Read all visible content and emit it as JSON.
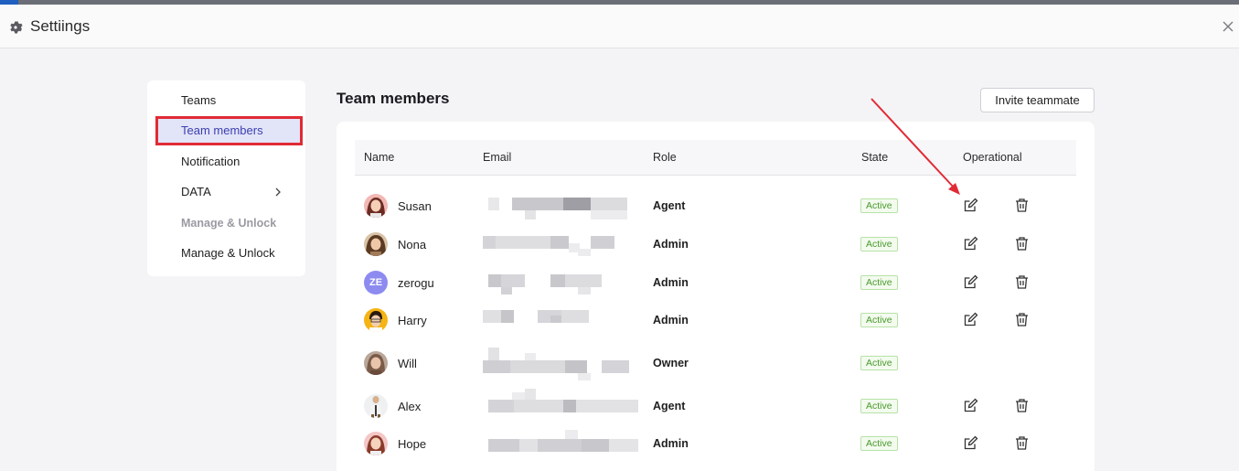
{
  "header": {
    "title": "Settiings"
  },
  "menu": {
    "items": [
      {
        "label": "Teams"
      },
      {
        "label": "Team members"
      },
      {
        "label": "Notification"
      },
      {
        "label": "DATA"
      },
      {
        "label": "Manage & Unlock"
      },
      {
        "label": "Manage & Unlock"
      }
    ]
  },
  "main": {
    "title": "Team members",
    "invite_label": "Invite teammate",
    "columns": [
      "Name",
      "Email",
      "Role",
      "State",
      "Operational"
    ],
    "rows": [
      {
        "name": "Susan",
        "role": "Agent",
        "state": "Active"
      },
      {
        "name": "Nona",
        "role": "Admin",
        "state": "Active"
      },
      {
        "name": "zerogu",
        "initials": "ZE",
        "role": "Admin",
        "state": "Active"
      },
      {
        "name": "Harry",
        "role": "Admin",
        "state": "Active"
      },
      {
        "name": "Will",
        "role": "Owner",
        "state": "Active"
      },
      {
        "name": "Alex",
        "role": "Agent",
        "state": "Active"
      },
      {
        "name": "Hope",
        "role": "Admin",
        "state": "Active"
      }
    ]
  },
  "colors": {
    "highlight_red": "#e02b35",
    "active_menu_bg": "#e2e4f8",
    "state_green": "#4a9a2c",
    "avatar_initials_bg": "#8d8bf0"
  },
  "icons": [
    "gear-icon",
    "close-icon",
    "chevron-right-icon",
    "edit-icon",
    "trash-icon"
  ]
}
